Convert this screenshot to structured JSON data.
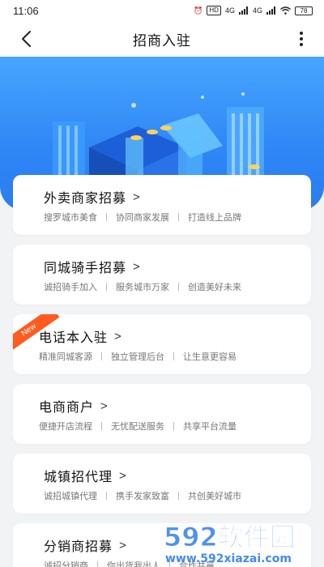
{
  "status_bar": {
    "time": "11:06",
    "hd": "HD",
    "network_1": "4G",
    "network_2": "4G",
    "battery": "78"
  },
  "nav": {
    "title": "招商入驻",
    "back_icon": "chevron-left-icon",
    "more_icon": "more-vertical-icon"
  },
  "banner": {
    "gradient_top": "#47a6ff",
    "gradient_bottom": "#2a7df0"
  },
  "cards": [
    {
      "title": "外卖商家招募",
      "features": [
        "搜罗城市美食",
        "协同商家发展",
        "打造线上品牌"
      ]
    },
    {
      "title": "同城骑手招募",
      "features": [
        "诚招骑手加入",
        "服务城市万家",
        "创造美好未来"
      ]
    },
    {
      "title": "电话本入驻",
      "badge": "New",
      "features": [
        "精准同城客源",
        "独立管理后台",
        "让生意更容易"
      ]
    },
    {
      "title": "电商商户",
      "features": [
        "便捷开店流程",
        "无忧配送服务",
        "共享平台流量"
      ]
    },
    {
      "title": "城镇招代理",
      "features": [
        "诚招城镇代理",
        "携手发家致富",
        "共创美好城市"
      ]
    },
    {
      "title": "分销商招募",
      "features": [
        "诚招分销商",
        "你出货我出人",
        "合作共赢"
      ]
    }
  ],
  "chevron": ">",
  "watermark": {
    "brand": "592软件园",
    "url": "www.592xiazai.com"
  }
}
